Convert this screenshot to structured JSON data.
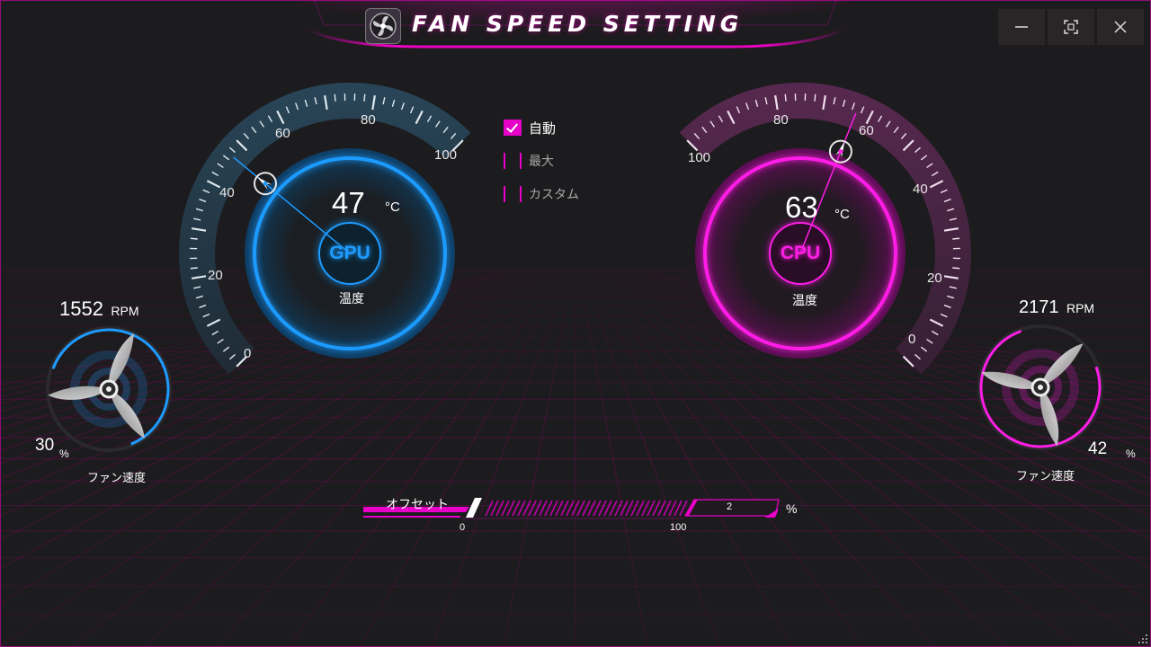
{
  "window": {
    "title": "FAN SPEED SETTING",
    "controls": {
      "minimize": "minimize",
      "maximize": "maximize",
      "close": "close"
    }
  },
  "gpu": {
    "label": "GPU",
    "temperature": "47",
    "temp_unit": "°C",
    "temp_caption": "温度",
    "scale_ticks": [
      "0",
      "20",
      "40",
      "60",
      "80",
      "100"
    ],
    "accent": "#1e9bff",
    "fan": {
      "rpm": "1552",
      "rpm_unit": "RPM",
      "percent": "30",
      "percent_unit": "%",
      "caption": "ファン速度"
    }
  },
  "cpu": {
    "label": "CPU",
    "temperature": "63",
    "temp_unit": "°C",
    "temp_caption": "温度",
    "scale_ticks": [
      "0",
      "20",
      "40",
      "60",
      "80",
      "100"
    ],
    "accent": "#ff1ee6",
    "fan": {
      "rpm": "2171",
      "rpm_unit": "RPM",
      "percent": "42",
      "percent_unit": "%",
      "caption": "ファン速度"
    }
  },
  "modes": [
    {
      "label": "自動",
      "checked": true
    },
    {
      "label": "最大",
      "checked": false
    },
    {
      "label": "カスタム",
      "checked": false
    }
  ],
  "offset": {
    "label": "オフセット",
    "min_label": "0",
    "max_label": "100",
    "value": "2",
    "unit": "%",
    "level_percent": 0
  },
  "colors": {
    "background": "#1c1b1d",
    "accent_pink": "#e600c8",
    "accent_blue": "#1e9bff"
  }
}
